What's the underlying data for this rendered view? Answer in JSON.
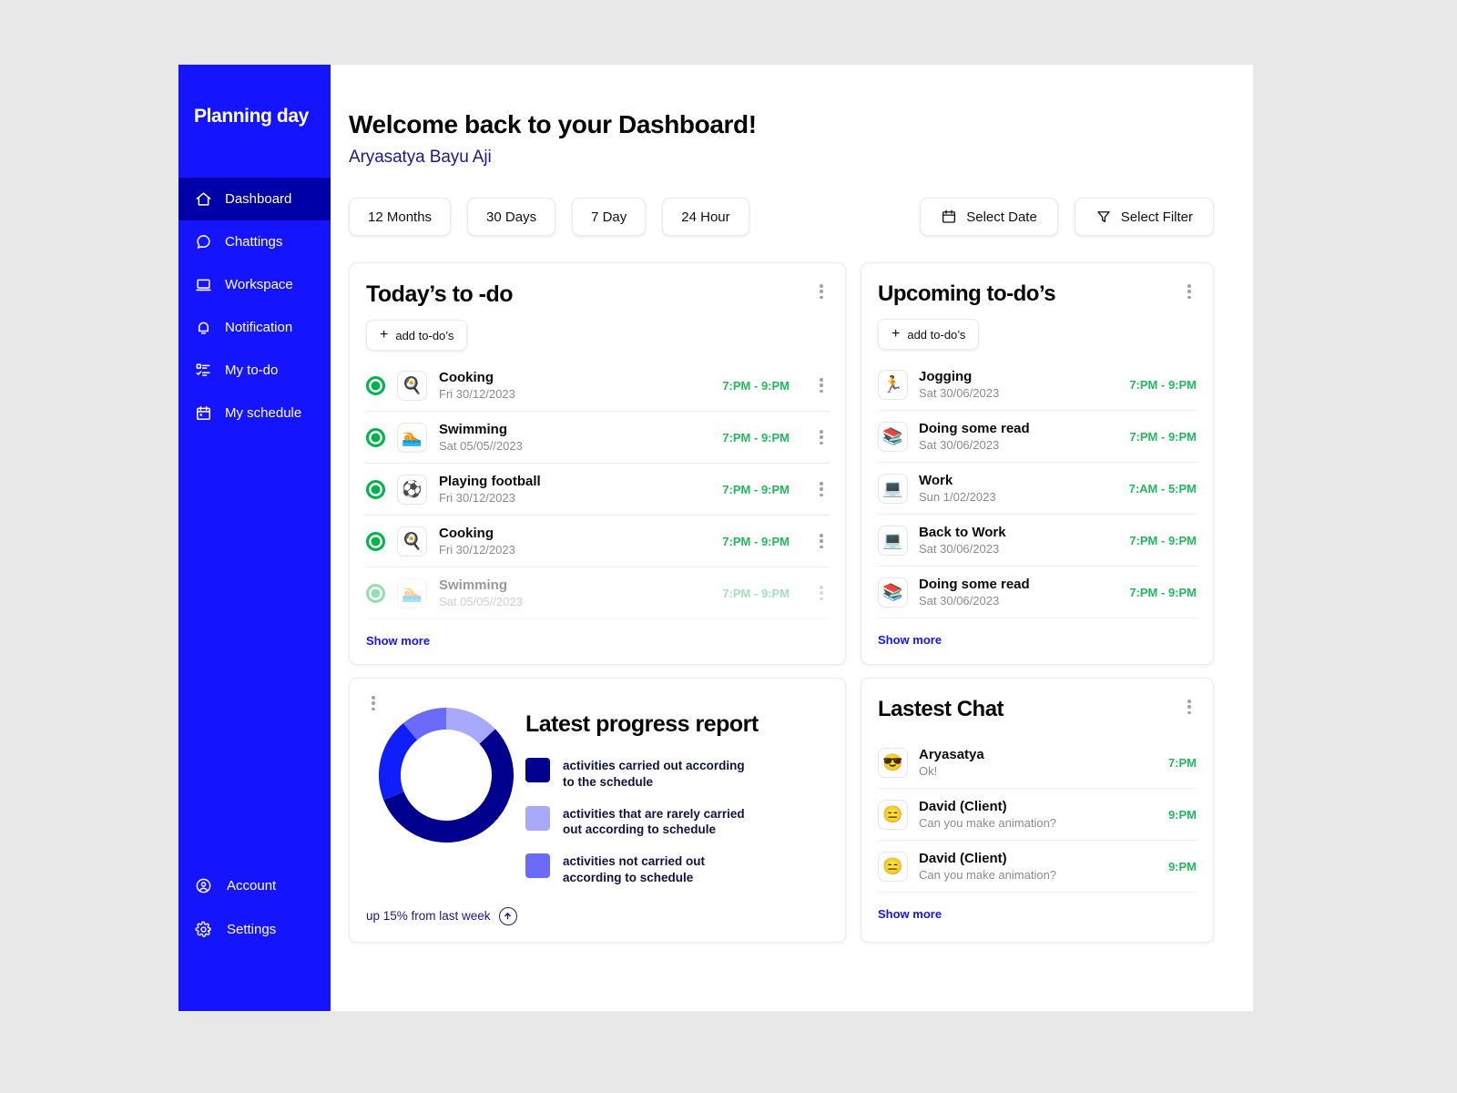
{
  "brand": {
    "name": "Planning day"
  },
  "sidebar": {
    "items": [
      {
        "label": "Dashboard",
        "icon": "home-icon",
        "active": true
      },
      {
        "label": "Chattings",
        "icon": "chat-bubble-icon",
        "active": false
      },
      {
        "label": "Workspace",
        "icon": "laptop-icon",
        "active": false
      },
      {
        "label": "Notification",
        "icon": "bell-icon",
        "active": false
      },
      {
        "label": "My to-do",
        "icon": "checklist-icon",
        "active": false
      },
      {
        "label": "My schedule",
        "icon": "calendar-icon",
        "active": false
      }
    ],
    "bottom_items": [
      {
        "label": "Account",
        "icon": "user-circle-icon"
      },
      {
        "label": "Settings",
        "icon": "gear-icon"
      }
    ]
  },
  "header": {
    "title": "Welcome back to your Dashboard!",
    "user_name": "Aryasatya Bayu Aji"
  },
  "toolbar": {
    "ranges": [
      "12 Months",
      "30 Days",
      "7 Day",
      "24 Hour"
    ],
    "select_date_label": "Select Date",
    "select_filter_label": "Select Filter"
  },
  "todays_todo": {
    "title": "Today’s to -do",
    "add_label": "add to-do’s",
    "show_more": "Show more",
    "items": [
      {
        "emoji": "🍳",
        "title": "Cooking",
        "date": "Fri 30/12/2023",
        "time": "7:PM - 9:PM",
        "faded": false
      },
      {
        "emoji": "🏊",
        "title": "Swimming",
        "date": "Sat 05/05//2023",
        "time": "7:PM - 9:PM",
        "faded": false
      },
      {
        "emoji": "⚽",
        "title": "Playing football",
        "date": "Fri 30/12/2023",
        "time": "7:PM - 9:PM",
        "faded": false
      },
      {
        "emoji": "🍳",
        "title": "Cooking",
        "date": "Fri 30/12/2023",
        "time": "7:PM - 9:PM",
        "faded": false
      },
      {
        "emoji": "🏊",
        "title": "Swimming",
        "date": "Sat 05/05//2023",
        "time": "7:PM - 9:PM",
        "faded": true
      }
    ]
  },
  "upcoming_todo": {
    "title": "Upcoming to-do’s",
    "add_label": "add to-do’s",
    "show_more": "Show more",
    "items": [
      {
        "emoji": "🏃",
        "title": "Jogging",
        "date": "Sat 30/06/2023",
        "time": "7:PM - 9:PM"
      },
      {
        "emoji": "📚",
        "title": "Doing some read",
        "date": "Sat 30/06/2023",
        "time": "7:PM - 9:PM"
      },
      {
        "emoji": "💻",
        "title": "Work",
        "date": "Sun 1/02/2023",
        "time": "7:AM - 5:PM"
      },
      {
        "emoji": "💻",
        "title": "Back to Work",
        "date": "Sat 30/06/2023",
        "time": "7:PM - 9:PM"
      },
      {
        "emoji": "📚",
        "title": "Doing some read",
        "date": "Sat 30/06/2023",
        "time": "7:PM - 9:PM"
      }
    ]
  },
  "progress_report": {
    "title": "Latest progress report",
    "footer_text": "up 15% from last week"
  },
  "chart_data": {
    "type": "pie",
    "title": "Latest progress report",
    "legend_position": "right",
    "labels": [
      "activities carried out according to the schedule",
      "activities that are rarely carried out according to schedule",
      "activities not carried out according to schedule"
    ],
    "legend_lines": [
      [
        "activities carried out according",
        "to the schedule"
      ],
      [
        "activities that are rarely carried",
        "out according to schedule"
      ],
      [
        "activities not carried out",
        "according to schedule"
      ]
    ],
    "colors": [
      "#00008f",
      "#a9a9fb",
      "#6a6afb"
    ],
    "segments": [
      {
        "label": "activities that are rarely carried out according to schedule",
        "value": 13,
        "color": "#a9a9fb"
      },
      {
        "label": "activities carried out according to the schedule",
        "value": 56,
        "color": "#00008f"
      },
      {
        "label": "bright-blue slice",
        "value": 20,
        "color": "#0f1ffb"
      },
      {
        "label": "activities not carried out according to schedule",
        "value": 11,
        "color": "#6a6afb"
      }
    ],
    "values": [
      56,
      13,
      11
    ],
    "units": "percent"
  },
  "latest_chat": {
    "title": "Lastest Chat",
    "show_more": "Show more",
    "items": [
      {
        "emoji": "😎",
        "name": "Aryasatya",
        "message": "Ok!",
        "time": "7:PM"
      },
      {
        "emoji": "😑",
        "name": "David (Client)",
        "message": "Can you make animation?",
        "time": "9:PM"
      },
      {
        "emoji": "😑",
        "name": "David (Client)",
        "message": "Can you make animation?",
        "time": "9:PM"
      }
    ]
  },
  "colors": {
    "sidebar_blue": "#1414ff",
    "sidebar_active": "#0000a8",
    "accent_navy": "#00008f",
    "green": "#21b95c",
    "link_blue": "#1414ff"
  }
}
